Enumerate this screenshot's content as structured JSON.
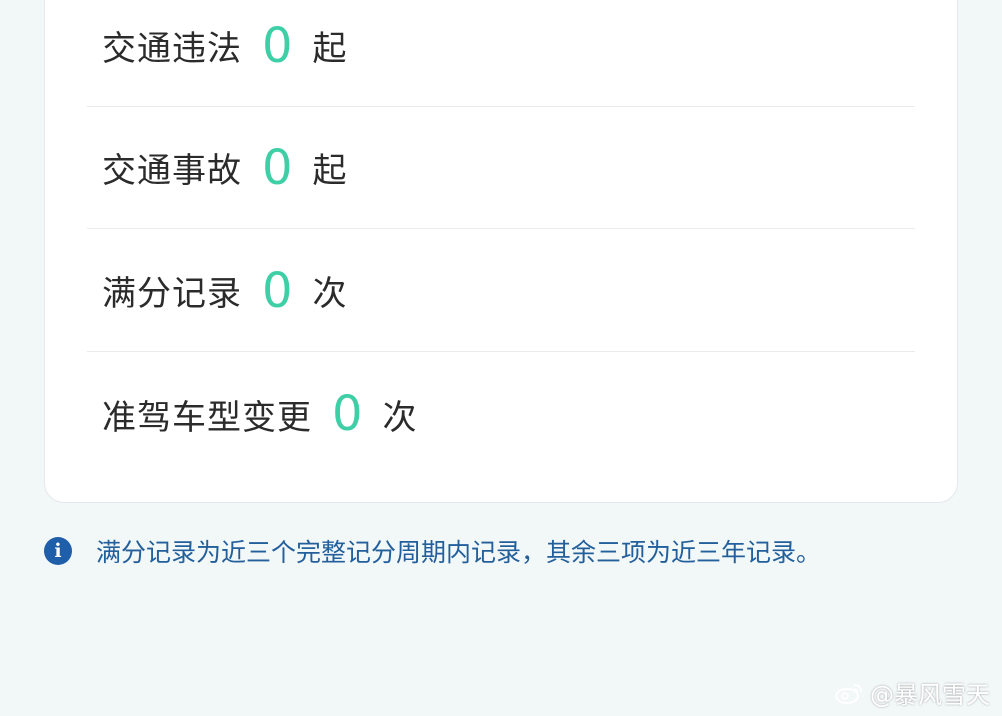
{
  "records": [
    {
      "label": "交通违法",
      "count": "0",
      "unit": "起"
    },
    {
      "label": "交通事故",
      "count": "0",
      "unit": "起"
    },
    {
      "label": "满分记录",
      "count": "0",
      "unit": "次"
    },
    {
      "label": "准驾车型变更",
      "count": "0",
      "unit": "次"
    }
  ],
  "note": {
    "icon": "info-icon",
    "text": "满分记录为近三个完整记分周期内记录，其余三项为近三年记录。"
  },
  "watermark": {
    "icon": "weibo-icon",
    "text": "@暴风雪天"
  },
  "colors": {
    "background": "#f2f7f8",
    "card": "#ffffff",
    "count_accent": "#3ecfa6",
    "note_text": "#235f9b",
    "info_icon": "#1f5ea8"
  }
}
